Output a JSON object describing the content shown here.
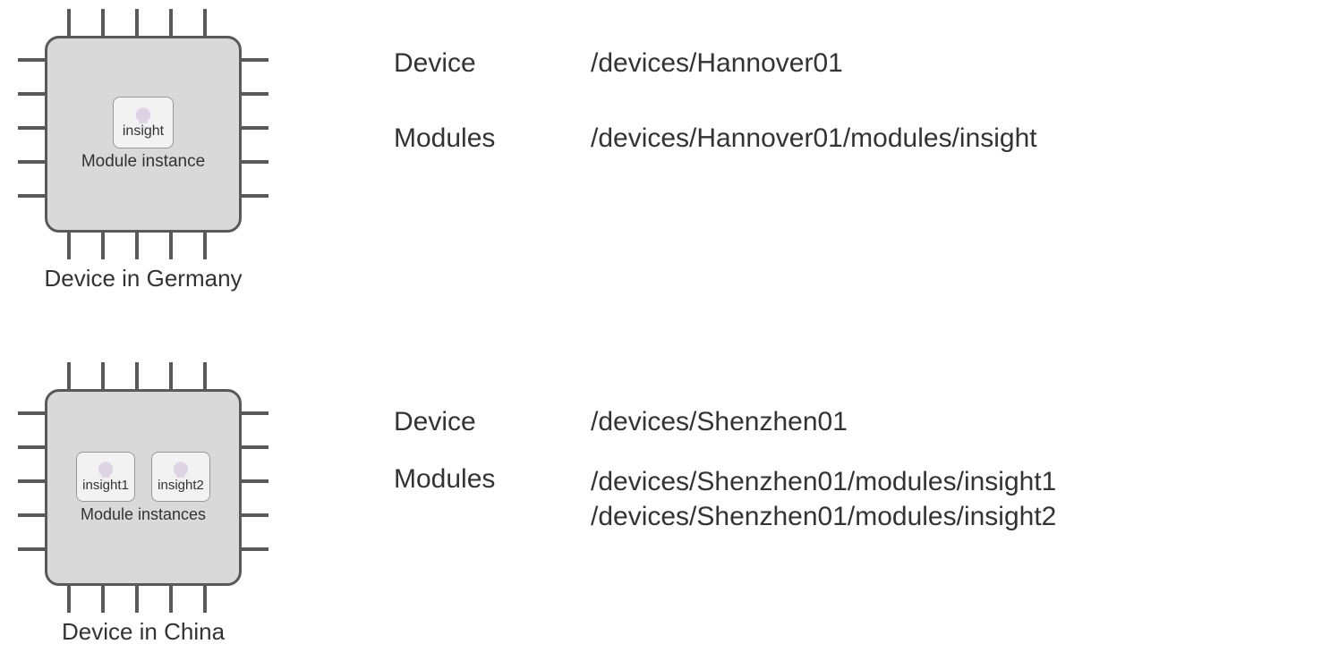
{
  "devices": [
    {
      "caption": "Device in Germany",
      "modules": [
        {
          "name": "insight"
        }
      ],
      "module_label": "Module instance",
      "info": {
        "device_label": "Device",
        "device_path": "/devices/Hannover01",
        "modules_label": "Modules",
        "module_paths": [
          "/devices/Hannover01/modules/insight"
        ]
      }
    },
    {
      "caption": "Device in China",
      "modules": [
        {
          "name": "insight1"
        },
        {
          "name": "insight2"
        }
      ],
      "module_label": "Module instances",
      "info": {
        "device_label": "Device",
        "device_path": "/devices/Shenzhen01",
        "modules_label": "Modules",
        "module_paths": [
          "/devices/Shenzhen01/modules/insight1",
          "/devices/Shenzhen01/modules/insight2"
        ]
      }
    }
  ]
}
